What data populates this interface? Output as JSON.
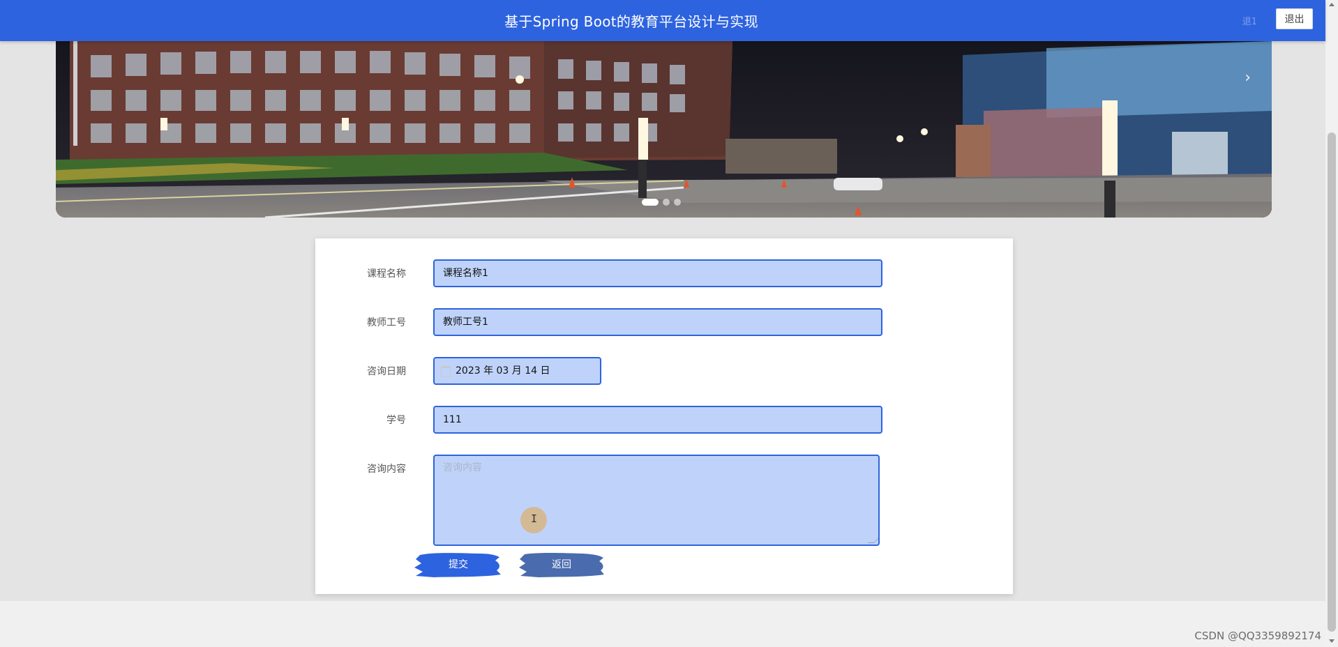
{
  "header": {
    "title": "基于Spring Boot的教育平台设计与实现",
    "user_hint": "退1",
    "logout_label": "退出",
    "bg_color": "#2e63df"
  },
  "banner": {
    "image": "campus-night-photo",
    "dots_count": 3,
    "active_dot": 0,
    "next_icon": "chevron-right-icon"
  },
  "form": {
    "course_name": {
      "label": "课程名称",
      "value": "课程名称1"
    },
    "teacher_id": {
      "label": "教师工号",
      "value": "教师工号1"
    },
    "consult_date": {
      "label": "咨询日期",
      "value": "2023 年 03 月 14 日",
      "icon": "calendar-icon"
    },
    "student_id": {
      "label": "学号",
      "value": "111"
    },
    "consult_content": {
      "label": "咨询内容",
      "placeholder": "咨询内容",
      "value": ""
    },
    "submit_label": "提交",
    "back_label": "返回",
    "field_bg": "#bfd3fa",
    "field_border": "#2e63df"
  },
  "watermark": "CSDN @QQ3359892174"
}
